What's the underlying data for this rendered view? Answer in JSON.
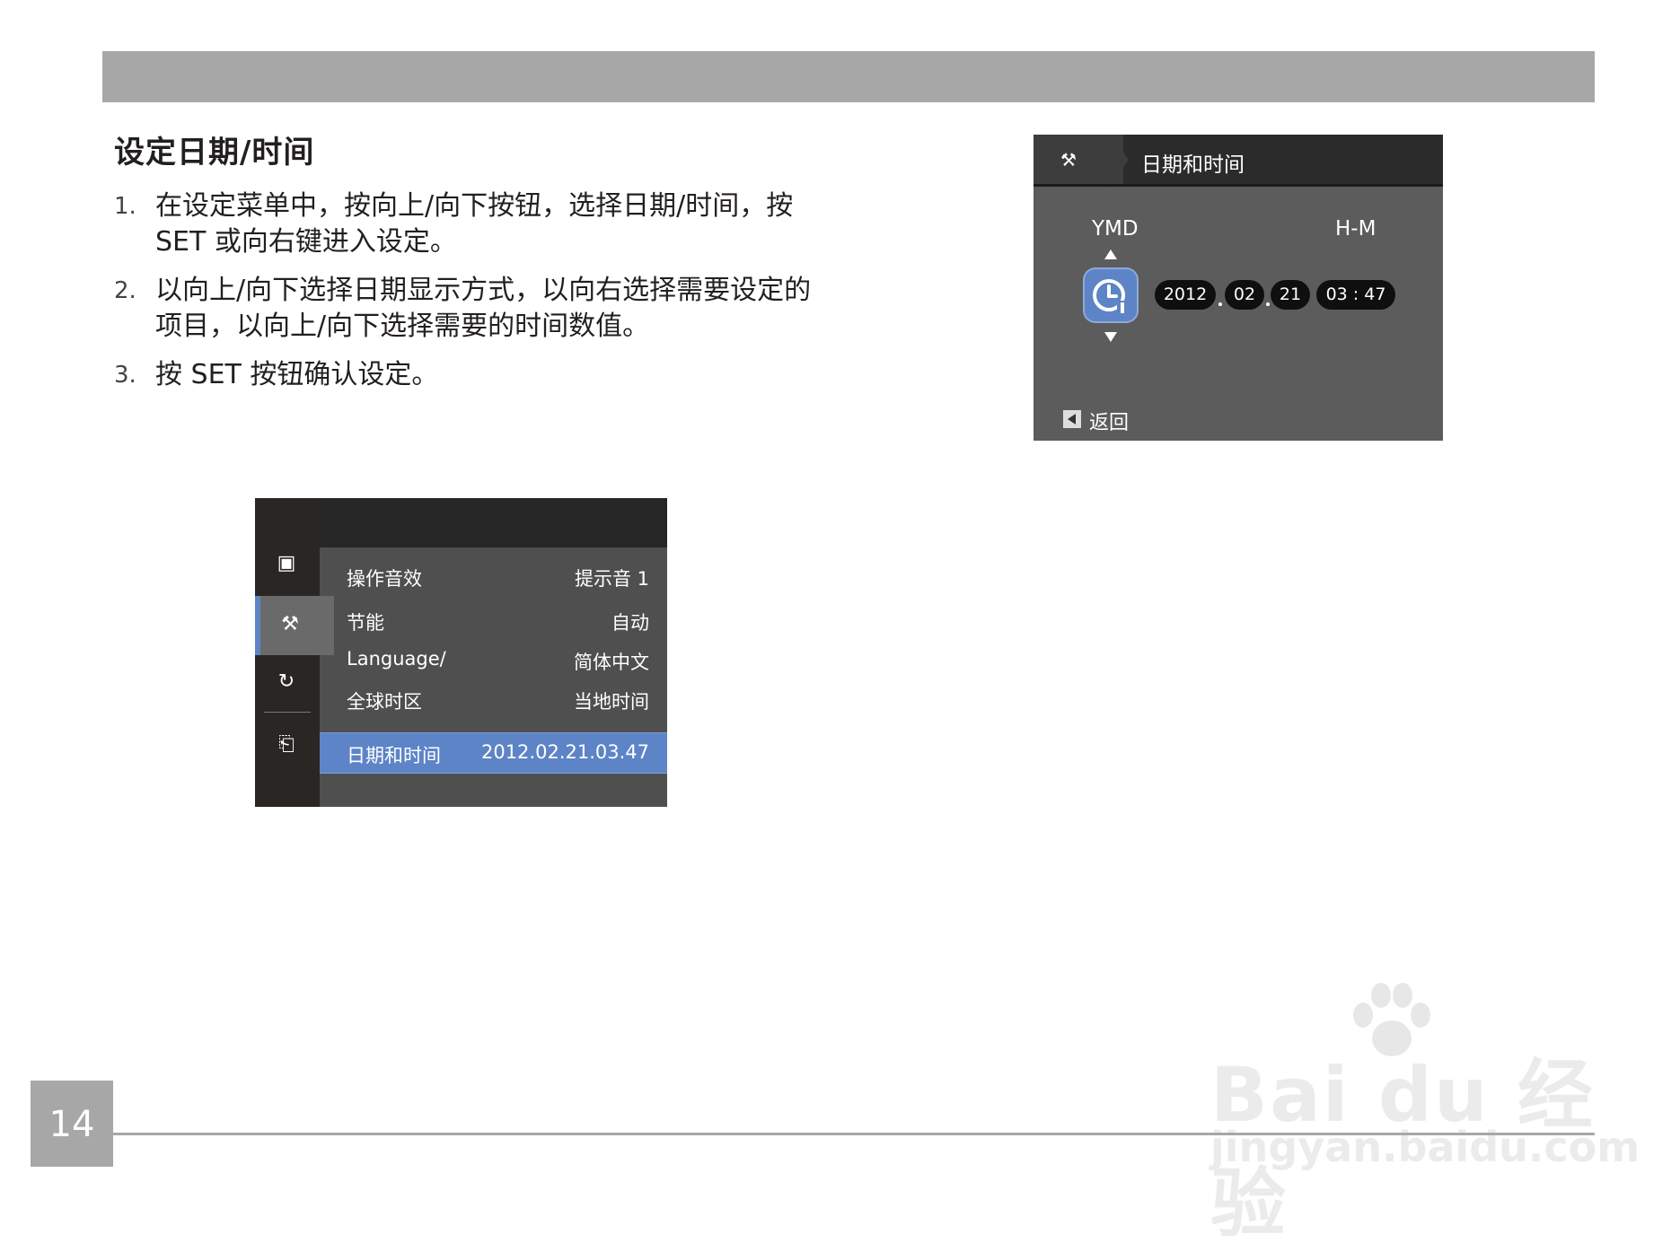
{
  "section_title": "设定日期/时间",
  "steps": [
    {
      "num": "1.",
      "text": "在设定菜单中，按向上/向下按钮，选择日期/时间，按 SET 或向右键进入设定。"
    },
    {
      "num": "2.",
      "text": "以向上/向下选择日期显示方式，以向右选择需要设定的项目，以向上/向下选择需要的时间数值。"
    },
    {
      "num": "3.",
      "text": "按 SET 按钮确认设定。"
    }
  ],
  "datetime_screen": {
    "title": "日期和时间",
    "format_label": "YMD",
    "time_label": "H-M",
    "year": "2012",
    "month": "02",
    "day": "21",
    "time": "03 : 47",
    "back_label": "返回",
    "accent_color": "#5d84c6"
  },
  "menu_screen": {
    "rows": [
      {
        "label": "操作音效",
        "value": "提示音 1"
      },
      {
        "label": "节能",
        "value": "自动"
      },
      {
        "label": "Language/",
        "value": "简体中文"
      },
      {
        "label": "全球时区",
        "value": "当地时间"
      },
      {
        "label": "日期和时间",
        "value": "2012.02.21.03.47",
        "selected": true
      }
    ]
  },
  "watermark": {
    "brand": "Bai du 经验",
    "url": "jingyan.baidu.com"
  },
  "page_number": "14"
}
